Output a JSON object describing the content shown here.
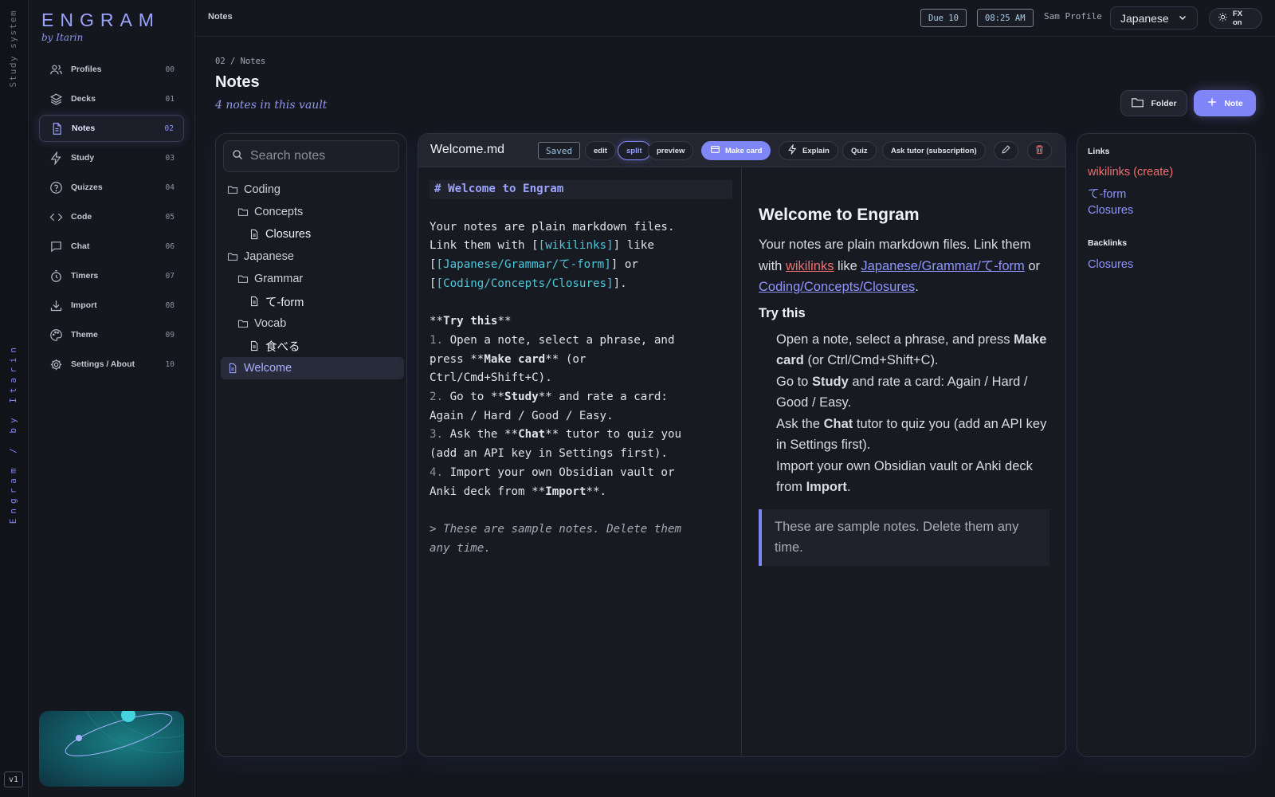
{
  "rail": {
    "top_text": "Study system",
    "bottom_text": "Engram / by Itarin",
    "version": "v1"
  },
  "brand": {
    "name": "ENGRAM",
    "by": "by Itarin"
  },
  "nav": [
    {
      "label": "Profiles",
      "num": "00",
      "icon": "users-icon"
    },
    {
      "label": "Decks",
      "num": "01",
      "icon": "layers-icon"
    },
    {
      "label": "Notes",
      "num": "02",
      "icon": "file-icon",
      "active": true
    },
    {
      "label": "Study",
      "num": "03",
      "icon": "bolt-icon"
    },
    {
      "label": "Quizzes",
      "num": "04",
      "icon": "help-circle-icon"
    },
    {
      "label": "Code",
      "num": "05",
      "icon": "code-icon"
    },
    {
      "label": "Chat",
      "num": "06",
      "icon": "chat-icon"
    },
    {
      "label": "Timers",
      "num": "07",
      "icon": "timer-icon"
    },
    {
      "label": "Import",
      "num": "08",
      "icon": "download-icon"
    },
    {
      "label": "Theme",
      "num": "09",
      "icon": "palette-icon"
    },
    {
      "label": "Settings / About",
      "num": "10",
      "icon": "gear-icon"
    }
  ],
  "topbar": {
    "crumb": "Notes",
    "due": "Due 10",
    "time": "08:25 AM",
    "profile": "Sam Profile",
    "language": "Japanese",
    "fx": "FX on"
  },
  "main": {
    "crumb": "02 / Notes",
    "title": "Notes",
    "subtitle": "4 notes in this vault",
    "folder_btn": "Folder",
    "note_btn": "Note"
  },
  "search": {
    "placeholder": "Search notes"
  },
  "tree": {
    "coding": "Coding",
    "concepts": "Concepts",
    "closures": "Closures",
    "japanese": "Japanese",
    "grammar": "Grammar",
    "teform": "て-form",
    "vocab": "Vocab",
    "taberu": "食べる",
    "welcome": "Welcome"
  },
  "editor": {
    "filename": "Welcome.md",
    "status": "Saved",
    "mode_edit": "edit",
    "mode_split": "split",
    "mode_preview": "preview",
    "make_card": "Make card",
    "explain": "Explain",
    "quiz": "Quiz",
    "ask_tutor": "Ask tutor (subscription)"
  },
  "source": {
    "heading": "# Welcome to Engram",
    "p1a": "Your notes are plain markdown files.",
    "p1b_pre": "Link them with [",
    "p1b_link": "[wikilinks]",
    "p1b_post": "] like",
    "p1c_pre": "[",
    "p1c_link": "[Japanese/Grammar/て-form]",
    "p1c_post": "] or",
    "p1d_pre": "[",
    "p1d_link": "[Coding/Concepts/Closures]",
    "p1d_post": "].",
    "try_pre": "**",
    "try_text": "Try this",
    "try_post": "**",
    "l1_num": "1.",
    "l1a": " Open a note, select a phrase, and",
    "l1b_pre": "press **",
    "l1b_bold": "Make card",
    "l1b_post": "** (or",
    "l1c": "Ctrl/Cmd+Shift+C).",
    "l2_num": "2.",
    "l2a_pre": " Go to **",
    "l2a_bold": "Study",
    "l2a_post": "** and rate a card:",
    "l2b": "Again / Hard / Good / Easy.",
    "l3_num": "3.",
    "l3a_pre": " Ask the **",
    "l3a_bold": "Chat",
    "l3a_post": "** tutor to quiz you",
    "l3b": "(add an API key in Settings first).",
    "l4_num": "4.",
    "l4a": " Import your own Obsidian vault or",
    "l4b_pre": "Anki deck from **",
    "l4b_bold": "Import",
    "l4b_post": "**.",
    "quote_a": "> These are sample notes. Delete them",
    "quote_b": "any time."
  },
  "preview": {
    "h1": "Welcome to Engram",
    "p1_a": "Your notes are plain markdown files. Link them with ",
    "p1_link1": "wikilinks",
    "p1_b": " like ",
    "p1_link2": "Japanese/Grammar/て-form",
    "p1_c": " or ",
    "p1_link3": "Coding/Concepts/Closures",
    "p1_d": ".",
    "h2": "Try this",
    "li1_a": "Open a note, select a phrase, and press ",
    "li1_b": "Make card",
    "li1_c": " (or Ctrl/Cmd+Shift+C).",
    "li2_a": "Go to ",
    "li2_b": "Study",
    "li2_c": " and rate a card: Again / Hard / Good / Easy.",
    "li3_a": "Ask the ",
    "li3_b": "Chat",
    "li3_c": " tutor to quiz you (add an API key in Settings first).",
    "li4_a": "Import your own Obsidian vault or Anki deck from ",
    "li4_b": "Import",
    "li4_c": ".",
    "quote": "These are sample notes. Delete them any time."
  },
  "links": {
    "links_heading": "Links",
    "link1": "wikilinks (create)",
    "link2": "て-form",
    "link3": "Closures",
    "backlinks_heading": "Backlinks",
    "backlink1": "Closures"
  },
  "colors": {
    "accent": "#8086f7",
    "link_missing": "#ee6f72",
    "link_existing": "#8e95ff",
    "source_link": "#4fc7d9"
  }
}
